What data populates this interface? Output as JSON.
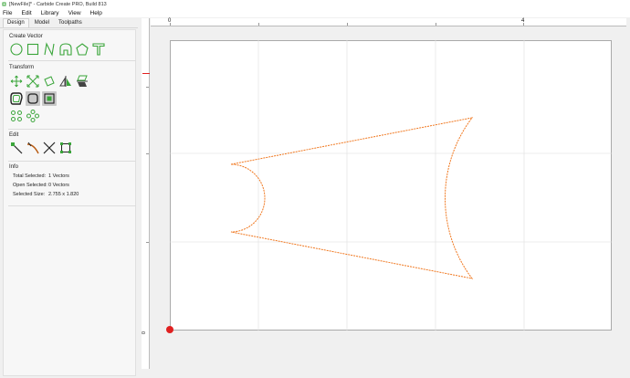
{
  "window": {
    "title": "[NewFile]* - Carbide Create PRO, Build 813"
  },
  "menu": {
    "items": [
      "File",
      "Edit",
      "Library",
      "View",
      "Help"
    ]
  },
  "left_panel": {
    "tabs": [
      "Design",
      "Model",
      "Toolpaths"
    ],
    "active_tab": "Design",
    "create_vector": {
      "title": "Create Vector",
      "tools": [
        "circle-icon",
        "rectangle-icon",
        "curve-icon",
        "polyline-icon",
        "polygon-icon",
        "text-icon"
      ]
    },
    "transform": {
      "title": "Transform",
      "tools": [
        "move-icon",
        "scale-icon",
        "rotate-icon",
        "mirror-icon",
        "align-icon",
        "offset-icon",
        "fillet-icon",
        "boolean-icon",
        "circular-array-icon",
        "grid-array-icon"
      ]
    },
    "edit": {
      "title": "Edit",
      "tools": [
        "edit-nodes-icon",
        "smooth-icon",
        "trim-icon",
        "join-icon"
      ]
    },
    "info": {
      "title": "Info",
      "total_selected_label": "Total Selected:",
      "total_selected_value": "1 Vectors",
      "open_selected_label": "Open Selected:",
      "open_selected_value": "0 Vectors",
      "selected_size_label": "Selected Size:",
      "selected_size_value": "2.755 x 1.820"
    }
  },
  "rulers": {
    "h_labels": [
      "0",
      "4"
    ],
    "v_label": "0"
  },
  "colors": {
    "accent": "#e02020",
    "vector": "#f07820",
    "tool_green": "#3aa53a"
  }
}
